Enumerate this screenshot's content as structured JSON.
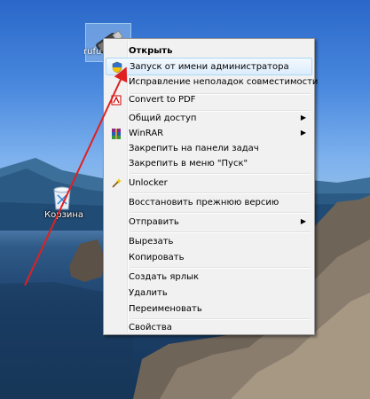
{
  "desktop": {
    "file_icon_label": "rufus",
    "recycle_bin_label": "Корзина"
  },
  "menu": {
    "items": [
      {
        "label": "Открыть",
        "bold": true,
        "icon": "none"
      },
      {
        "label": "Запуск от имени администратора",
        "icon": "uac-shield-icon",
        "highlighted": true
      },
      {
        "label": "Исправление неполадок совместимости",
        "icon": "none"
      },
      {
        "label": "Convert to PDF",
        "icon": "pdf-icon"
      },
      {
        "label": "Общий доступ",
        "icon": "none",
        "submenu": true
      },
      {
        "label": "WinRAR",
        "icon": "winrar-icon",
        "submenu": true
      },
      {
        "label": "Закрепить на панели задач",
        "icon": "none"
      },
      {
        "label": "Закрепить в меню \"Пуск\"",
        "icon": "none"
      },
      {
        "label": "Unlocker",
        "icon": "unlocker-wand-icon"
      },
      {
        "label": "Восстановить прежнюю версию",
        "icon": "none"
      },
      {
        "label": "Отправить",
        "icon": "none",
        "submenu": true
      },
      {
        "label": "Вырезать",
        "icon": "none"
      },
      {
        "label": "Копировать",
        "icon": "none"
      },
      {
        "label": "Создать ярлык",
        "icon": "none"
      },
      {
        "label": "Удалить",
        "icon": "none"
      },
      {
        "label": "Переименовать",
        "icon": "none"
      },
      {
        "label": "Свойства",
        "icon": "none"
      }
    ],
    "submenu_arrow": "▶"
  },
  "colors": {
    "annotation_arrow": "#e02020",
    "highlight_border": "#a8d8f8"
  }
}
